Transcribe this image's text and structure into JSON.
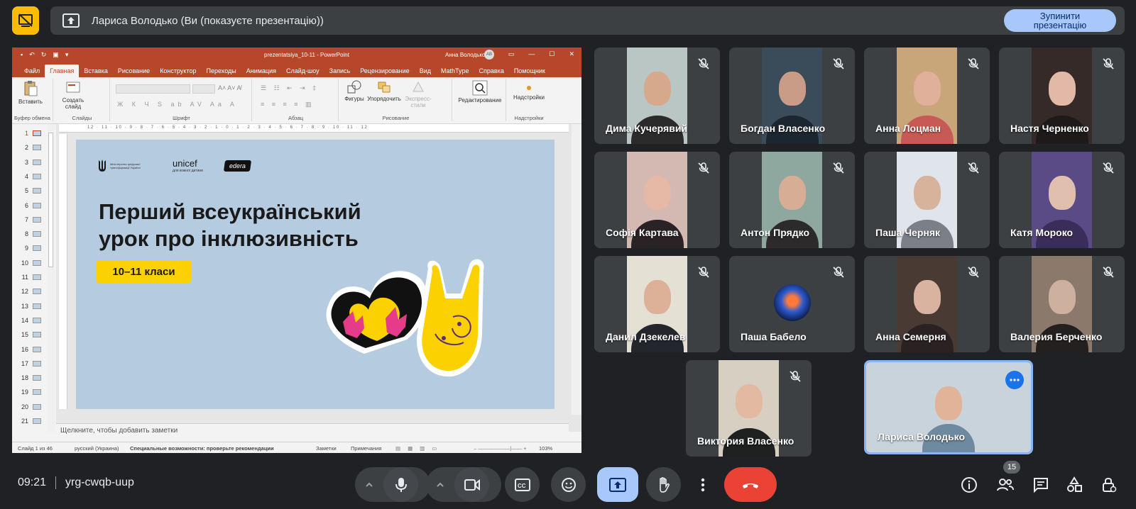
{
  "presentation_bar": {
    "presenter_text": "Лариса Володько (Ви (показуєте презентацію))",
    "stop_button": "Зупинити презентацію"
  },
  "powerpoint": {
    "file_name": "prezentatsiya_10-11  -  PowerPoint",
    "user_name": "Анна Володько",
    "user_initials": "АВ",
    "tabs": [
      "Файл",
      "Главная",
      "Вставка",
      "Рисование",
      "Конструктор",
      "Переходы",
      "Анимация",
      "Слайд-шоу",
      "Запись",
      "Рецензирование",
      "Вид",
      "MathType",
      "Справка",
      "Помощник"
    ],
    "active_tab": "Главная",
    "ribbon": {
      "paste": "Вставить",
      "new_slide": "Создать слайд",
      "shapes": "Фигуры",
      "arrange": "Упорядочить",
      "quick_styles": "Экспресс-стили",
      "editing": "Редактирование",
      "addins": "Надстройки",
      "groups": [
        "Буфер обмена",
        "Слайды",
        "Шрифт",
        "Абзац",
        "Рисование",
        "Надстройки"
      ]
    },
    "slide_numbers": [
      "1",
      "2",
      "3",
      "4",
      "5",
      "6",
      "7",
      "8",
      "9",
      "10",
      "11",
      "12",
      "13",
      "14",
      "15",
      "16",
      "17",
      "18",
      "19",
      "20",
      "21"
    ],
    "ruler_ticks": "12 · 11 · 10 · 9 · 8 · 7 · 6 · 5 · 4 · 3 · 2 · 1 · 0 · 1 · 2 · 3 · 4 · 5 · 6 · 7 · 8 · 9 · 10 · 11 · 12",
    "slide": {
      "ministry_text": "Міністерство цифрової трансформації України",
      "unicef": "unicef",
      "unicef_sub": "для кожної дитини",
      "edera": "edera",
      "title_line1": "Перший всеукраїнський",
      "title_line2": "урок про інклюзивність",
      "grade": "10–11 класи"
    },
    "notes_placeholder": "Щелкните, чтобы добавить заметки",
    "status": {
      "slide_info": "Слайд 1 из 46",
      "language": "русский (Украина)",
      "accessibility": "Специальные возможности: проверьте рекомендации",
      "notes": "Заметки",
      "comments": "Примечания",
      "zoom": "103%"
    }
  },
  "participants": [
    {
      "name": "Дима Кучерявий",
      "bg": "#b9c6c3",
      "skin": "#d6a98c",
      "shirt": "#2b2b2b"
    },
    {
      "name": "Богдан Власенко",
      "bg": "#3a4b5a",
      "skin": "#c89c86",
      "shirt": "#1c2630"
    },
    {
      "name": "Анна Лоцман",
      "bg": "#c9a57a",
      "skin": "#e0b09a",
      "shirt": "#c85a55"
    },
    {
      "name": "Настя Черненко",
      "bg": "#352a28",
      "skin": "#e2b8a6",
      "shirt": "#1e1a1a"
    },
    {
      "name": "Софія Картава",
      "bg": "#d4b8b2",
      "skin": "#e6b9a6",
      "shirt": "#2a2326"
    },
    {
      "name": "Антон Прядко",
      "bg": "#8ea8a0",
      "skin": "#d7ae95",
      "shirt": "#2c2a2a"
    },
    {
      "name": "Паша Черняк",
      "bg": "#dfe5ea",
      "skin": "#d8b39c",
      "shirt": "#7a7f88"
    },
    {
      "name": "Катя Мороко",
      "bg": "#5a4a86",
      "skin": "#e1bfae",
      "shirt": "#3b2d5a"
    },
    {
      "name": "Данил Дзекелев",
      "bg": "#e4e0d4",
      "skin": "#ddb197",
      "shirt": "#23262c"
    },
    {
      "name": "Паша Бабело",
      "bg": "#3c4043",
      "skin": "#2e5bd0",
      "shirt": "#3c4043"
    },
    {
      "name": "Анна Семерня",
      "bg": "#4a3a34",
      "skin": "#d9b3a0",
      "shirt": "#2a2222"
    },
    {
      "name": "Валерия Берченко",
      "bg": "#8b7a6c",
      "skin": "#cdb0a0",
      "shirt": "#252020"
    },
    {
      "name": "Виктория Власенко",
      "bg": "#d8cfc3",
      "skin": "#e4b9a2",
      "shirt": "#1f2020"
    },
    {
      "name": "Лариса Володько",
      "bg": "#c8d3dc",
      "skin": "#e1b398",
      "shirt": "#6e8aa0"
    }
  ],
  "bottom_bar": {
    "time": "09:21",
    "meeting_code": "yrg-cwqb-uup",
    "participant_count": "15"
  },
  "colors": {
    "background": "#202124",
    "tile": "#3c4043",
    "accent_blue": "#a8c7fa",
    "end_call_red": "#ea4335",
    "logo_yellow": "#fbbc04",
    "ppt_red": "#b7472a"
  }
}
